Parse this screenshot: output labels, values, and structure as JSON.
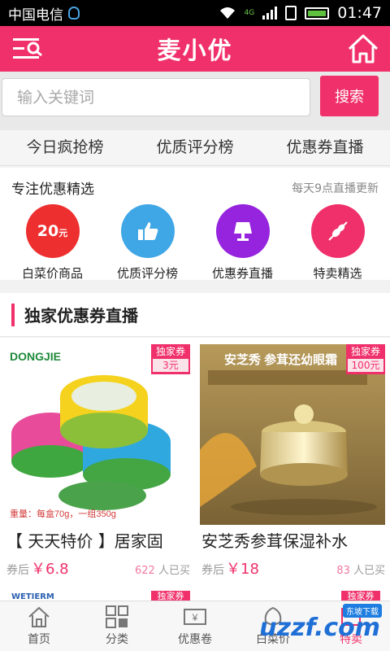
{
  "status_bar": {
    "carrier": "中国电信",
    "network": "4G",
    "time": "01:47"
  },
  "header": {
    "title": "麦小优"
  },
  "search": {
    "placeholder": "输入关键词",
    "button": "搜索"
  },
  "tabs": [
    "今日疯抢榜",
    "优质评分榜",
    "优惠券直播"
  ],
  "featured": {
    "title": "专注优惠精选",
    "subtitle": "每天9点直播更新",
    "price_icon_value": "20",
    "price_icon_unit": "元",
    "items": [
      {
        "label": "白菜价商品",
        "icon": "price-tag-icon",
        "color": "#ee2f2f"
      },
      {
        "label": "优质评分榜",
        "icon": "thumbs-up-icon",
        "color": "#3fa7e6"
      },
      {
        "label": "优惠券直播",
        "icon": "lamp-icon",
        "color": "#9624de"
      },
      {
        "label": "特卖精选",
        "icon": "skewer-icon",
        "color": "#f0306a"
      }
    ]
  },
  "section": {
    "title": "独家优惠券直播"
  },
  "products": [
    {
      "brand": "DONGJIE",
      "image_caption": "重量：每盒70g，一组350g",
      "badge_label": "独家券",
      "badge_value": "3元",
      "name": "【 天天特价 】居家固",
      "after_label": "券后",
      "price": "￥6.8",
      "sold_count": "622",
      "sold_label": "人已买"
    },
    {
      "brand": "安芝秀 参茸还幼眼霜",
      "image_caption": "",
      "badge_label": "独家券",
      "badge_value": "100元",
      "name": "安芝秀参茸保湿补水",
      "after_label": "券后",
      "price": "￥18",
      "sold_count": "83",
      "sold_label": "人已买"
    }
  ],
  "next_row": {
    "brand": "WETIERM",
    "badge_label": "独家券"
  },
  "bottom_nav": [
    {
      "label": "首页",
      "icon": "home-icon"
    },
    {
      "label": "分类",
      "icon": "grid-icon"
    },
    {
      "label": "优惠卷",
      "icon": "coupon-icon"
    },
    {
      "label": "白菜价",
      "icon": "cabbage-icon"
    },
    {
      "label": "特卖",
      "icon": "sale-icon"
    }
  ],
  "watermark": {
    "badge": "东坡下载",
    "text": "uzzf.com"
  }
}
